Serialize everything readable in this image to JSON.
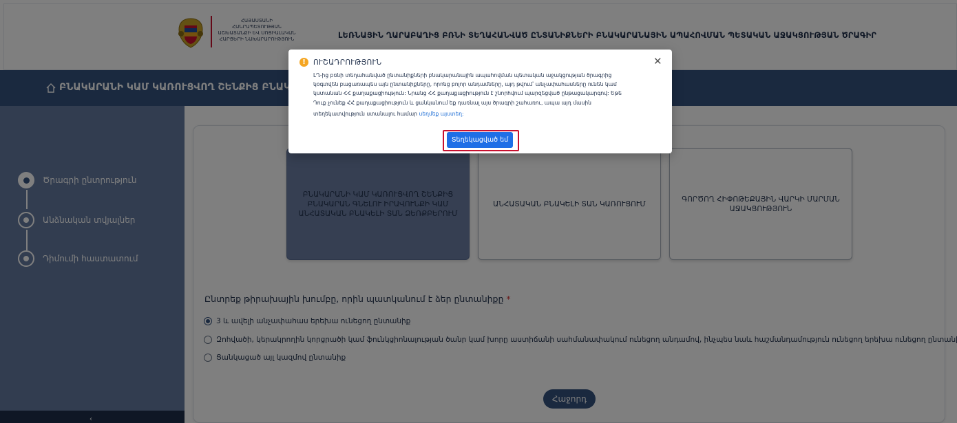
{
  "header": {
    "ministry": "ՀԱՅԱՍՏԱՆԻ ՀԱՆՐԱՊԵՏՈՒԹՅԱՆ ԱՇԽԱՏԱՆՔԻ ԵՎ ՍՈՑԻԱԼԱԿԱՆ ՀԱՐՑԵՐԻ ՆԱԽԱՐԱՐՈՒԹՅՈՒՆ",
    "program_title": "ԼԵՌՆԱՅԻՆ ՂԱՐԱԲԱՂԻՑ ԲՌՆԻ ՏԵՂԱՀԱՆՎԱԾ ԸՆՏԱՆԻՔՆԵՐԻ ԲՆԱԿԱՐԱՆԱՅԻՆ ԱՊԱՀՈՎՄԱՆ ՊԵՏԱԿԱՆ ԱՋԱԿՑՈՒԹՅԱՆ ԾՐԱԳԻՐ"
  },
  "banner": {
    "title": "ԲՆԱԿԱՐԱՆԻ ԿԱՄ ԿԱՌՈՒՑՎՈՂ ՇԵՆՔԻՑ ԲՆԱԿԱՐԱՆ"
  },
  "sidebar": {
    "steps": [
      {
        "label": "Ծրագրի ընտրություն"
      },
      {
        "label": "Անձնական տվյալներ"
      },
      {
        "label": "Դիմումի հաստատում"
      }
    ],
    "collapse_icon": "chevron-left-icon"
  },
  "options": [
    {
      "label": "ԲՆԱԿԱՐԱՆԻ ԿԱՄ ԿԱՌՈՒՑՎՈՂ ՇԵՆՔԻՑ ԲՆԱԿԱՐԱՆ ԳՆԵԼՈՒ ԻՐԱՎՈՒՆՔԻ ԿԱՄ ԱՆՀԱՏԱԿԱՆ ԲՆԱԿԵԼԻ ՏԱՆ ՁԵՌՔԲԵՐՈՒՄ",
      "selected": true
    },
    {
      "label": "ԱՆՀԱՏԱԿԱՆ ԲՆԱԿԵԼԻ ՏԱՆ ԿԱՌՈՒՑՈՒՄ",
      "selected": false
    },
    {
      "label": "ԳՈՐԾՈՂ ՀԻՓՈԹԵՔԱՅԻՆ ՎԱՐԿԻ ՄԱՐՄԱՆ ԱՋԱԿՑՈՒԹՅՈՒՆ",
      "selected": false
    }
  ],
  "question": {
    "label": "Ընտրեք թիրախային խումբը, որին պատկանում է ձեր ընտանիքը",
    "required_mark": "*",
    "choices": [
      {
        "label": "3 և ավելի անչափահաս երեխա ունեցող ընտանիք",
        "checked": true
      },
      {
        "label": "Զոհվածի, կերակրողին կորցրածի կամ ֆունկցիոնալության ծանր կամ խորը աստիճանի սահմանափակում ունեցող անդամով, ինչպես նաև հաշմանդամություն ունեցող երեխա ունեցող ընտանիք",
        "checked": false
      },
      {
        "label": "Ցանկացած այլ կազմով ընտանիք",
        "checked": false
      }
    ]
  },
  "next_button": {
    "label": "Հաջորդ"
  },
  "modal": {
    "title": "ՈՒՇԱԴՐՈՒԹՅՈՒՆ",
    "body_lines": [
      "ԼՂ-ից բռնի տեղահանված ընտանիքների բնակարանային ապահովման պետական աջակցության ծրագրից",
      "կօգտվեն բացառապես այն ընտանիքները, որոնց բոլոր անդամները, այդ թվում՝ անչափահասները ունեն կամ",
      "կստանան ՀՀ քաղաքացիություն: Նրանց ՀՀ քաղաքացիություն է շնորհվում պարզեցված ընթացակարգով: Եթե",
      "Դուք չունեք ՀՀ քաղաքացիություն և ցանկանում եք դառնալ այս ծրագրի շահառու, ապա այդ մասին"
    ],
    "last_line_prefix": "տեղեկատվություն ստանալու համար",
    "link_text": "սեղմեք այստեղ:",
    "confirm_label": "Տեղեկացված եմ",
    "close_icon": "close-icon",
    "warning_icon": "warning-icon",
    "accent_color": "#1f6fe6",
    "highlight_color": "#c8102e"
  }
}
